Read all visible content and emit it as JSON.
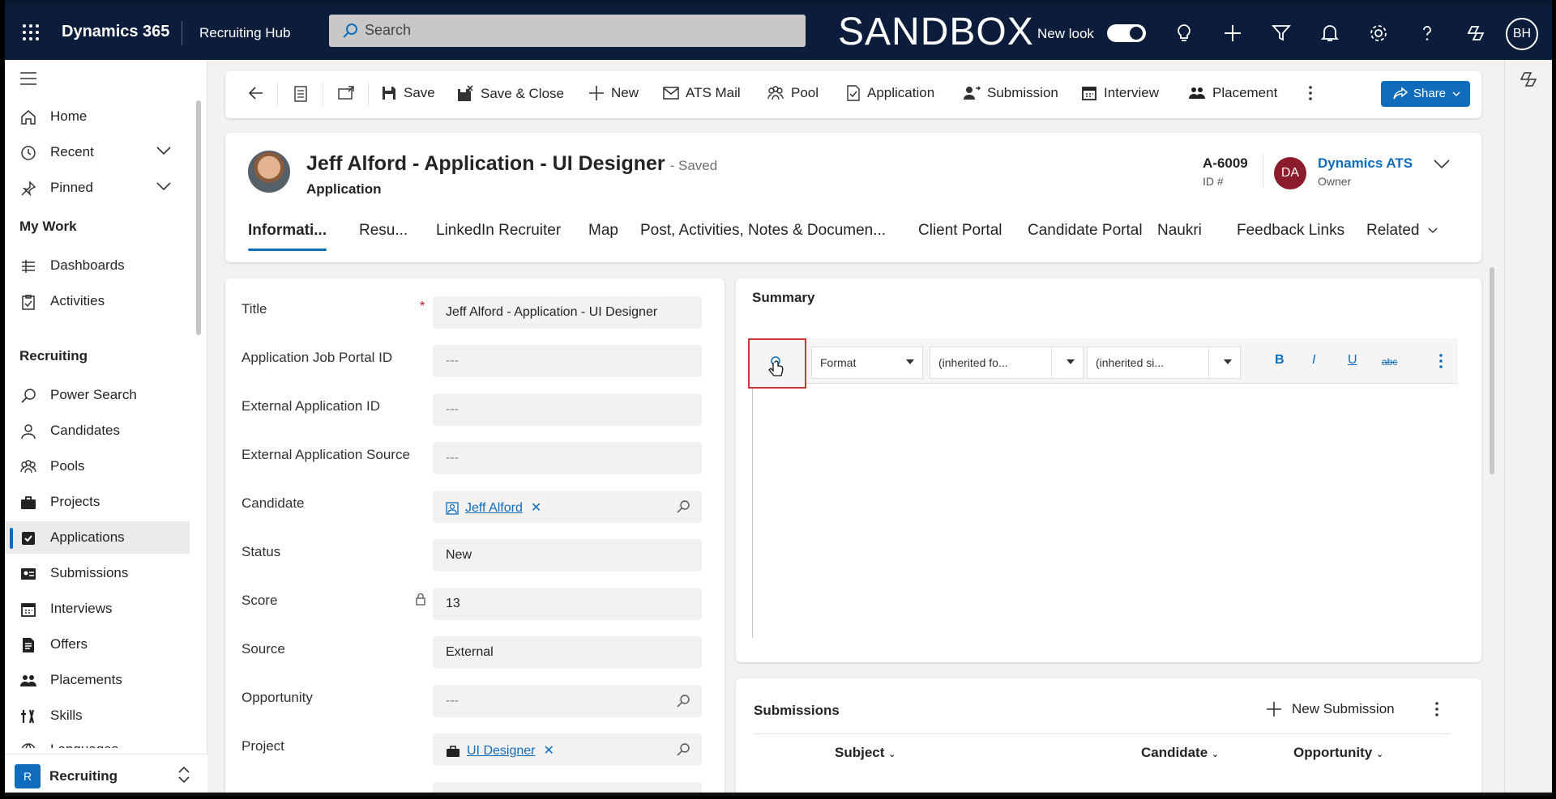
{
  "topbar": {
    "brand": "Dynamics 365",
    "app_name": "Recruiting Hub",
    "search_placeholder": "Search",
    "environment": "SANDBOX",
    "new_look_label": "New look",
    "new_look_enabled": true,
    "user_initials": "BH"
  },
  "nav": {
    "items_top": [
      {
        "label": "Home",
        "icon": "home-icon"
      },
      {
        "label": "Recent",
        "icon": "clock-icon"
      },
      {
        "label": "Pinned",
        "icon": "pin-icon"
      }
    ],
    "my_work_heading": "My Work",
    "my_work": [
      {
        "label": "Dashboards",
        "icon": "dashboard-icon"
      },
      {
        "label": "Activities",
        "icon": "clipboard-icon"
      }
    ],
    "recruiting_heading": "Recruiting",
    "recruiting": [
      {
        "label": "Power Search",
        "icon": "search-icon"
      },
      {
        "label": "Candidates",
        "icon": "person-icon"
      },
      {
        "label": "Pools",
        "icon": "people-icon"
      },
      {
        "label": "Projects",
        "icon": "briefcase-icon"
      },
      {
        "label": "Applications",
        "icon": "checkbox-icon",
        "active": true
      },
      {
        "label": "Submissions",
        "icon": "contact-card-icon"
      },
      {
        "label": "Interviews",
        "icon": "calendar-icon"
      },
      {
        "label": "Offers",
        "icon": "document-icon"
      },
      {
        "label": "Placements",
        "icon": "group-icon"
      },
      {
        "label": "Skills",
        "icon": "skills-icon"
      },
      {
        "label": "Languages",
        "icon": "globe-icon"
      }
    ],
    "area_badge": "R",
    "area_label": "Recruiting"
  },
  "commands": {
    "save": "Save",
    "save_close": "Save & Close",
    "new": "New",
    "ats_mail": "ATS Mail",
    "pool": "Pool",
    "application": "Application",
    "submission": "Submission",
    "interview": "Interview",
    "placement": "Placement",
    "share": "Share"
  },
  "record": {
    "title": "Jeff Alford - Application - UI Designer",
    "saved_status": "- Saved",
    "entity": "Application",
    "id_value": "A-6009",
    "id_label": "ID #",
    "owner_initials": "DA",
    "owner_name": "Dynamics ATS",
    "owner_role": "Owner"
  },
  "tabs": [
    "Informati...",
    "Resu...",
    "LinkedIn Recruiter",
    "Map",
    "Post, Activities, Notes & Documen...",
    "Client Portal",
    "Candidate Portal",
    "Naukri",
    "Feedback Links",
    "Related"
  ],
  "form": {
    "title": {
      "label": "Title",
      "value": "Jeff Alford - Application - UI Designer"
    },
    "job_portal_id": {
      "label": "Application Job Portal ID",
      "value": "---"
    },
    "external_id": {
      "label": "External Application ID",
      "value": "---"
    },
    "external_source": {
      "label": "External Application Source",
      "value": "---"
    },
    "candidate": {
      "label": "Candidate",
      "value": "Jeff Alford"
    },
    "status": {
      "label": "Status",
      "value": "New"
    },
    "score": {
      "label": "Score",
      "value": "13"
    },
    "source": {
      "label": "Source",
      "value": "External"
    },
    "opportunity": {
      "label": "Opportunity",
      "value": "---"
    },
    "project": {
      "label": "Project",
      "value": "UI Designer"
    }
  },
  "summary": {
    "title": "Summary",
    "format_label": "Format",
    "font_placeholder": "(inherited fo...",
    "size_placeholder": "(inherited si...",
    "bold": "B",
    "italic": "I",
    "underline": "U",
    "strike": "abc"
  },
  "submissions": {
    "title": "Submissions",
    "new_label": "New Submission",
    "columns": [
      "Subject",
      "Candidate",
      "Opportunity"
    ]
  },
  "colors": {
    "topbar": "#0b1d3a",
    "accent": "#0f6cbd",
    "owner_avatar": "#8b1c2c",
    "highlight": "#d13438"
  }
}
